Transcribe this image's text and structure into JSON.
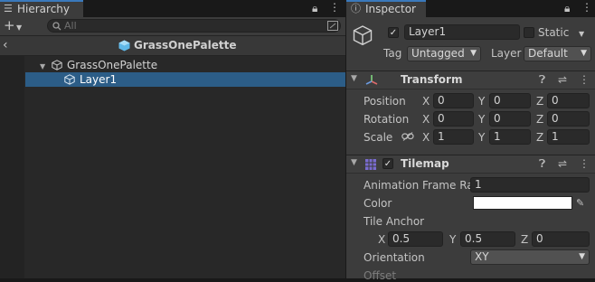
{
  "hierarchy": {
    "tab_title": "Hierarchy",
    "search_placeholder": "All",
    "breadcrumb_title": "GrassOnePalette",
    "tree": [
      {
        "label": "GrassOnePalette",
        "selected": false
      },
      {
        "label": "Layer1",
        "selected": true
      }
    ]
  },
  "inspector": {
    "tab_title": "Inspector",
    "object": {
      "name": "Layer1",
      "active": true,
      "static_label": "Static",
      "static_checked": false,
      "tag_label": "Tag",
      "tag_value": "Untagged",
      "layer_label": "Layer",
      "layer_value": "Default"
    },
    "transform": {
      "title": "Transform",
      "rows": [
        {
          "label": "Position",
          "x": "0",
          "y": "0",
          "z": "0"
        },
        {
          "label": "Rotation",
          "x": "0",
          "y": "0",
          "z": "0"
        },
        {
          "label": "Scale",
          "x": "1",
          "y": "1",
          "z": "1"
        }
      ],
      "axis_x": "X",
      "axis_y": "Y",
      "axis_z": "Z"
    },
    "tilemap": {
      "title": "Tilemap",
      "enabled": true,
      "anim_rate_label": "Animation Frame Rate",
      "anim_rate_value": "1",
      "color_label": "Color",
      "color_value": "#ffffff",
      "tile_anchor_label": "Tile Anchor",
      "anchor_x": "0.5",
      "anchor_y": "0.5",
      "anchor_z": "0",
      "orientation_label": "Orientation",
      "orientation_value": "XY",
      "offset_label": "Offset"
    }
  },
  "colors": {
    "selection": "#2c5d87",
    "tab_accent": "#3a79bb",
    "panel": "#3c3c3c"
  }
}
